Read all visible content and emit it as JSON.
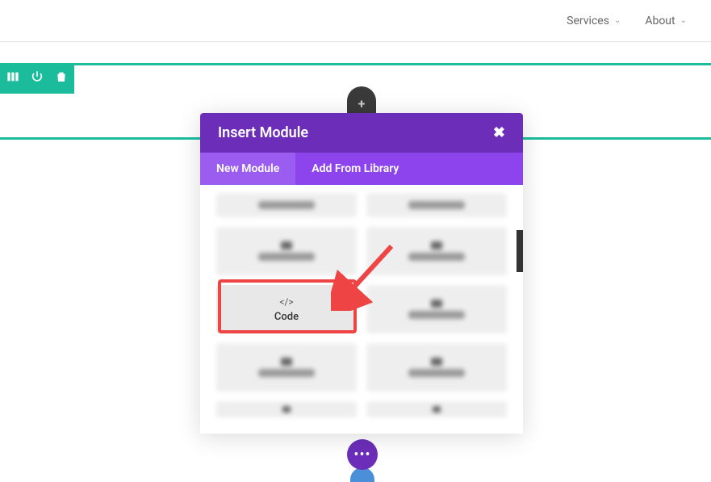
{
  "nav": {
    "services": "Services",
    "about": "About"
  },
  "modal": {
    "title": "Insert Module",
    "tabs": {
      "new": "New Module",
      "library": "Add From Library"
    },
    "modules": {
      "code": {
        "label": "Code",
        "icon": "</>"
      }
    }
  }
}
